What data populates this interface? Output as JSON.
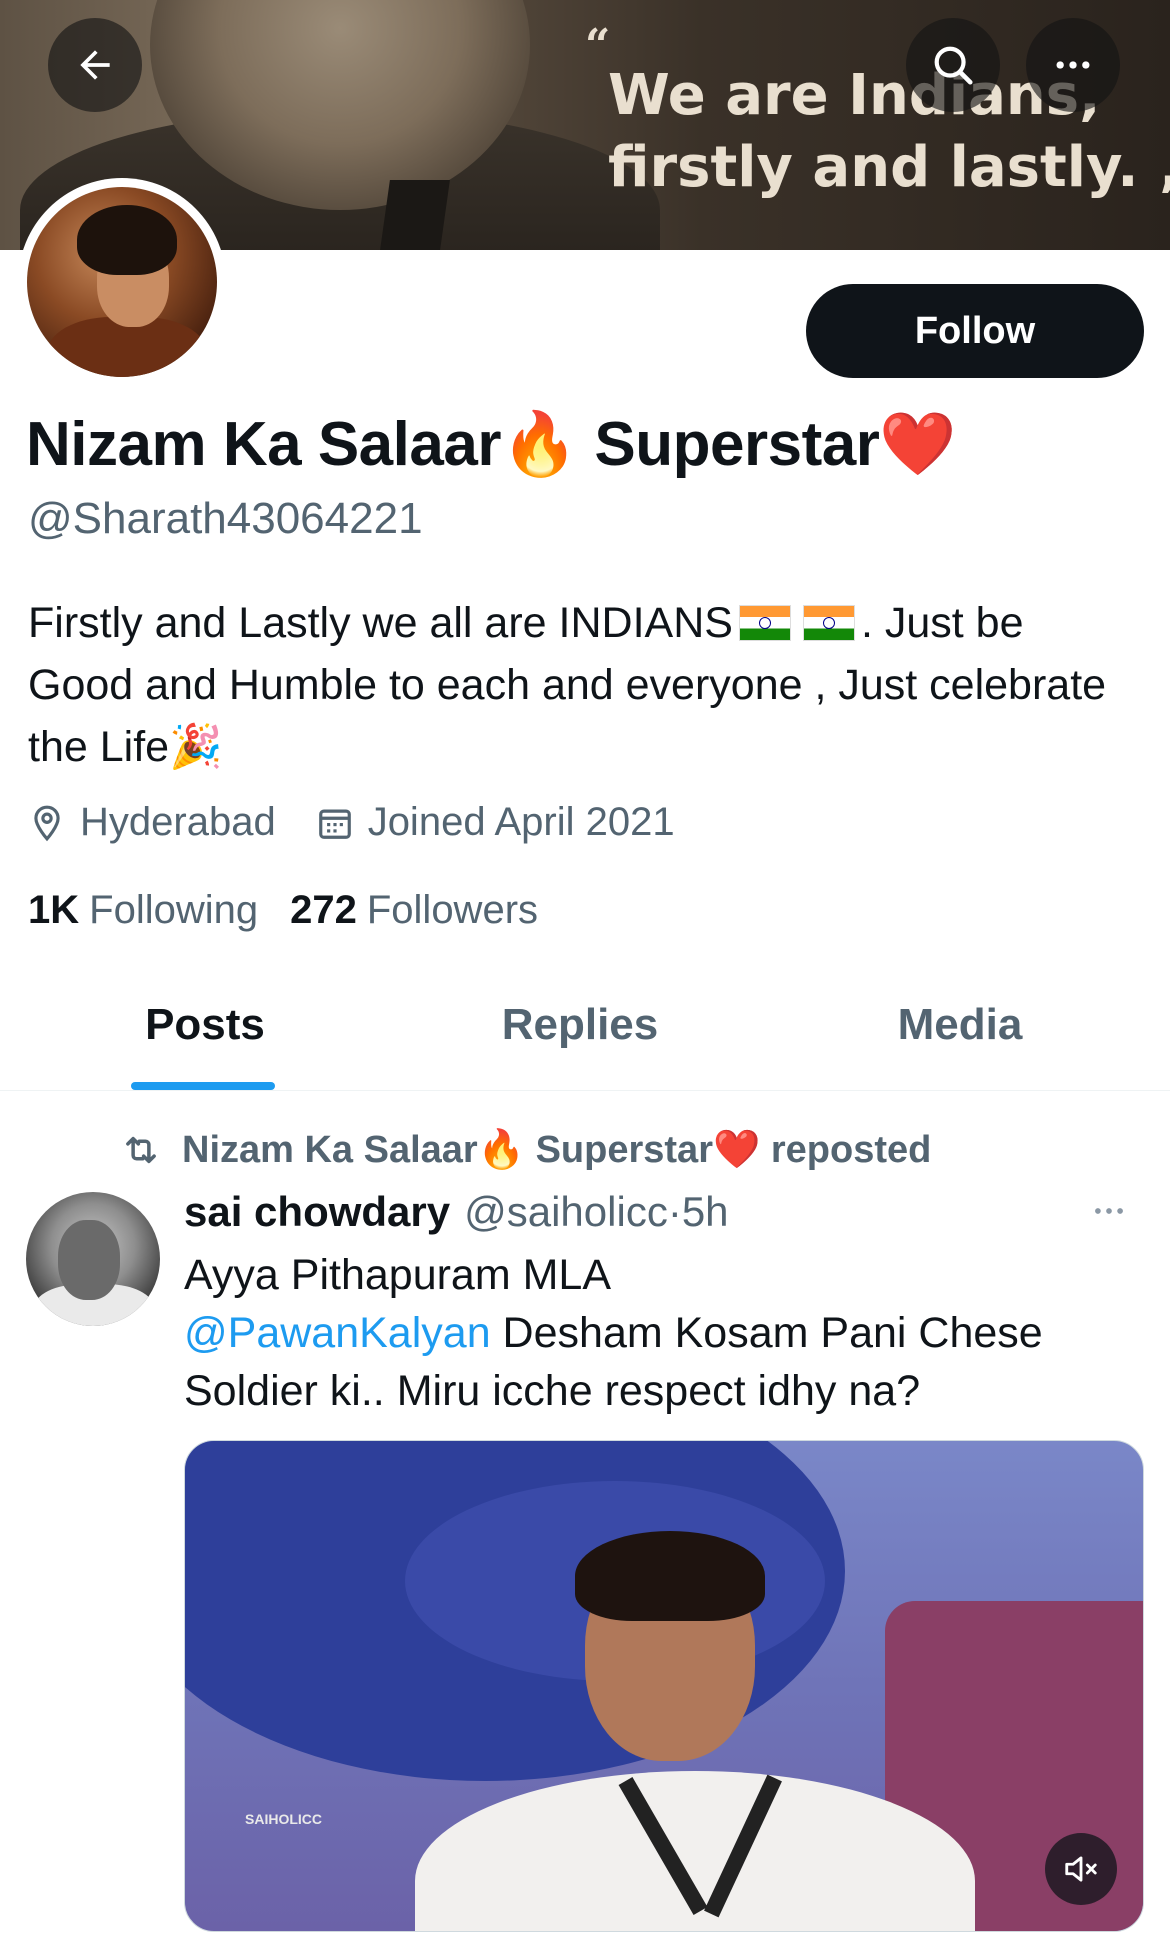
{
  "banner": {
    "quote_open": "“",
    "quote_line1": "We are Indians,",
    "quote_line2": "firstly and lastly. „"
  },
  "header": {
    "back_icon": "arrow-left-icon",
    "search_icon": "search-icon",
    "more_icon": "more-horizontal-icon"
  },
  "profile": {
    "follow_label": "Follow",
    "display_name": "Nizam Ka Salaar🔥 Superstar❤️",
    "handle": "@Sharath43064221",
    "bio_part1": "Firstly and Lastly we all are INDIANS",
    "bio_part2": ". Just be Good and Humble to each and everyone , Just celebrate the Life🎉",
    "location": "Hyderabad",
    "joined": "Joined April 2021",
    "following_count": "1K",
    "following_label": "Following",
    "followers_count": "272",
    "followers_label": "Followers"
  },
  "tabs": [
    {
      "label": "Posts",
      "active": true
    },
    {
      "label": "Replies",
      "active": false
    },
    {
      "label": "Media",
      "active": false
    }
  ],
  "post": {
    "repost_text": "Nizam Ka Salaar🔥 Superstar❤️ reposted",
    "author": "sai chowdary",
    "author_handle": "@saiholicc",
    "time": "5h",
    "text_line1": "Ayya Pithapuram MLA",
    "mention": "@PawanKalyan",
    "text_rest": " Desham Kosam Pani Chese Soldier ki.. Miru icche respect idhy na?",
    "media_watermark": "SAIHOLICC",
    "mute_icon": "speaker-muted-icon"
  },
  "colors": {
    "accent": "#1d9bf0",
    "text_primary": "#0f1419",
    "text_secondary": "#536471"
  }
}
